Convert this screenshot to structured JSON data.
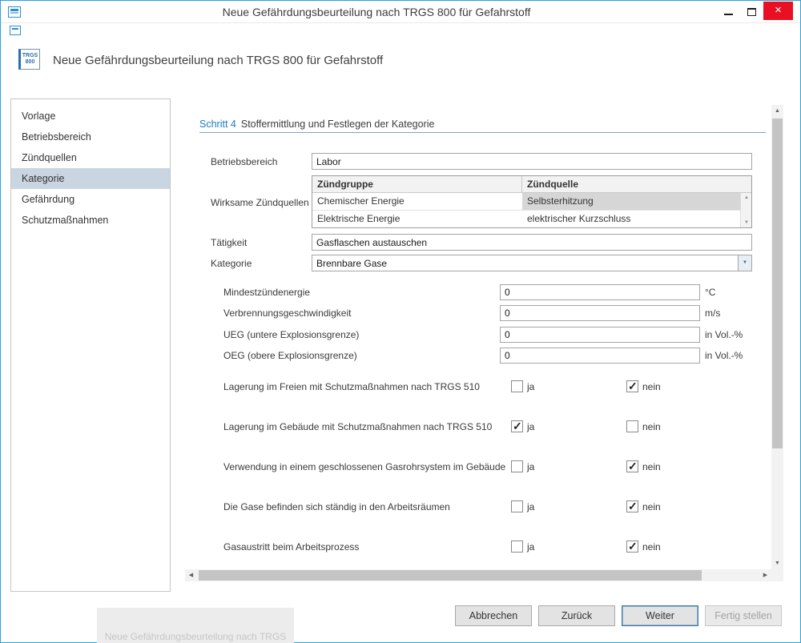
{
  "window": {
    "title": "Neue Gefährdungsbeurteilung nach TRGS 800 für Gefahrstoff"
  },
  "header": {
    "icon_line1": "TRGS",
    "icon_line2": "800",
    "title": "Neue Gefährdungsbeurteilung nach TRGS 800 für Gefahrstoff"
  },
  "sidebar": {
    "items": [
      {
        "label": "Vorlage",
        "selected": false
      },
      {
        "label": "Betriebsbereich",
        "selected": false
      },
      {
        "label": "Zündquellen",
        "selected": false
      },
      {
        "label": "Kategorie",
        "selected": true
      },
      {
        "label": "Gefährdung",
        "selected": false
      },
      {
        "label": "Schutzmaßnahmen",
        "selected": false
      }
    ]
  },
  "step": {
    "number": "Schritt 4",
    "title": "Stoffermittlung und Festlegen der Kategorie"
  },
  "form": {
    "betriebsbereich": {
      "label": "Betriebsbereich",
      "value": "Labor"
    },
    "zuendquellen": {
      "label": "Wirksame Zündquellen",
      "columns": [
        "Zündgruppe",
        "Zündquelle"
      ],
      "rows": [
        {
          "gruppe": "Chemischer Energie",
          "quelle": "Selbsterhitzung",
          "selected": true
        },
        {
          "gruppe": "Elektrische Energie",
          "quelle": "elektrischer Kurzschluss",
          "selected": false
        }
      ]
    },
    "taetigkeit": {
      "label": "Tätigkeit",
      "value": "Gasflaschen austauschen"
    },
    "kategorie": {
      "label": "Kategorie",
      "value": "Brennbare Gase"
    },
    "numeric_fields": [
      {
        "label": "Mindestzündenergie",
        "value": "0",
        "unit": "°C"
      },
      {
        "label": "Verbrennungsgeschwindigkeit",
        "value": "0",
        "unit": "m/s"
      },
      {
        "label": "UEG (untere Explosionsgrenze)",
        "value": "0",
        "unit": "in Vol.-%"
      },
      {
        "label": "OEG (obere Explosionsgrenze)",
        "value": "0",
        "unit": "in Vol.-%"
      }
    ],
    "yes_label": "ja",
    "no_label": "nein",
    "checkbox_rows": [
      {
        "label": "Lagerung im Freien mit Schutzmaßnahmen nach TRGS 510",
        "ja": false,
        "nein": true
      },
      {
        "label": "Lagerung im Gebäude mit Schutzmaßnahmen nach TRGS 510",
        "ja": true,
        "nein": false
      },
      {
        "label": "Verwendung in einem geschlossenen Gasrohrsystem im Gebäude",
        "ja": false,
        "nein": true
      },
      {
        "label": "Die Gase befinden sich ständig in den Arbeitsräumen",
        "ja": false,
        "nein": true
      },
      {
        "label": "Gasaustritt beim Arbeitsprozess",
        "ja": false,
        "nein": true
      }
    ]
  },
  "footer": {
    "buttons": [
      {
        "label": "Abbrechen",
        "disabled": false,
        "focused": false
      },
      {
        "label": "Zurück",
        "disabled": false,
        "focused": false
      },
      {
        "label": "Weiter",
        "disabled": false,
        "focused": true
      },
      {
        "label": "Fertig stellen",
        "disabled": true,
        "focused": false
      }
    ]
  },
  "background_artifact": {
    "text": "Neue Gefährdungsbeurteilung nach TRGS"
  },
  "icons": {
    "close": "×",
    "dropdown": "▼",
    "scroll_up": "▲",
    "scroll_down": "▼",
    "scroll_left": "◀",
    "scroll_right": "▶",
    "check": "✓"
  },
  "colors": {
    "window_border": "#29a3d8",
    "close_button": "#e81123",
    "accent_blue": "#1e7ac0",
    "sidebar_selected": "#c9d5e0",
    "row_selected": "#d6d6d6"
  }
}
